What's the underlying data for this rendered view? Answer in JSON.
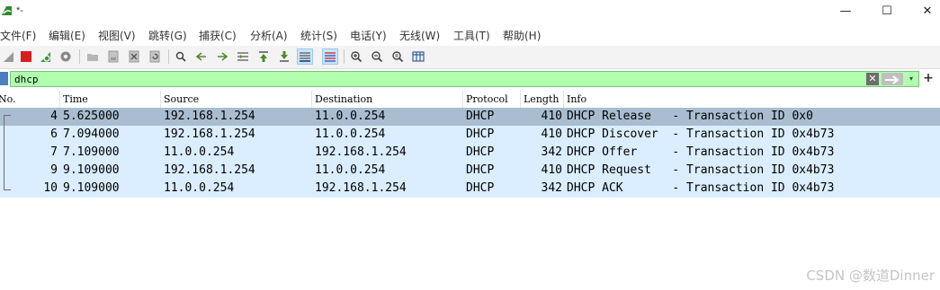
{
  "window": {
    "title": "*-",
    "minimize_glyph": "—",
    "maximize_glyph": "☐",
    "close_glyph": "✕"
  },
  "menu": [
    "文件(F)",
    "编辑(E)",
    "视图(V)",
    "跳转(G)",
    "捕获(C)",
    "分析(A)",
    "统计(S)",
    "电话(Y)",
    "无线(W)",
    "工具(T)",
    "帮助(H)"
  ],
  "toolbar": {
    "icons": [
      "shark-fin-start-icon",
      "stop-capture-icon",
      "restart-capture-icon",
      "capture-options-icon",
      "open-file-icon",
      "save-file-icon",
      "close-file-icon",
      "reload-file-icon",
      "find-packet-icon",
      "go-back-icon",
      "go-forward-icon",
      "go-to-packet-icon",
      "first-packet-icon",
      "last-packet-icon",
      "auto-scroll-icon",
      "colorize-icon",
      "zoom-in-icon",
      "zoom-out-icon",
      "normal-size-icon",
      "resize-columns-icon"
    ]
  },
  "filter": {
    "value": "dhcp",
    "clear_glyph": "✕",
    "dropdown_glyph": "▾",
    "add_glyph": "+"
  },
  "packet_list": {
    "columns": [
      "No.",
      "Time",
      "Source",
      "Destination",
      "Protocol",
      "Length",
      "Info"
    ],
    "rows": [
      {
        "no": "4",
        "time": "5.625000",
        "source": "192.168.1.254",
        "destination": "11.0.0.254",
        "protocol": "DHCP",
        "length": "410",
        "info": "DHCP Release   - Transaction ID 0x0",
        "selected": true
      },
      {
        "no": "6",
        "time": "7.094000",
        "source": "192.168.1.254",
        "destination": "11.0.0.254",
        "protocol": "DHCP",
        "length": "410",
        "info": "DHCP Discover  - Transaction ID 0x4b73",
        "selected": false
      },
      {
        "no": "7",
        "time": "7.109000",
        "source": "11.0.0.254",
        "destination": "192.168.1.254",
        "protocol": "DHCP",
        "length": "342",
        "info": "DHCP Offer     - Transaction ID 0x4b73",
        "selected": false
      },
      {
        "no": "9",
        "time": "9.109000",
        "source": "192.168.1.254",
        "destination": "11.0.0.254",
        "protocol": "DHCP",
        "length": "410",
        "info": "DHCP Request   - Transaction ID 0x4b73",
        "selected": false
      },
      {
        "no": "10",
        "time": "9.109000",
        "source": "11.0.0.254",
        "destination": "192.168.1.254",
        "protocol": "DHCP",
        "length": "342",
        "info": "DHCP ACK       - Transaction ID 0x4b73",
        "selected": false
      }
    ]
  },
  "watermark": "CSDN @数道Dinner",
  "colors": {
    "filter_valid": "#afffaf",
    "row_bg": "#daeeff",
    "row_selected": "#a9bdd1"
  }
}
